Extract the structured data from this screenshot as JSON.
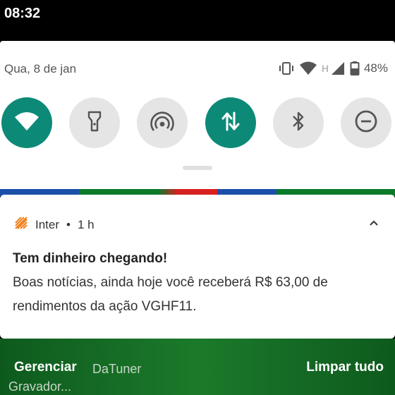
{
  "status_bar": {
    "time": "08:32"
  },
  "shade": {
    "date": "Qua, 8 de jan",
    "battery": "48%",
    "icons": [
      "vibrate-icon",
      "wifi-icon",
      "network-type-icon",
      "signal-icon",
      "battery-icon"
    ],
    "network_type": "H"
  },
  "quick_settings": [
    {
      "name": "wifi",
      "icon": "wifi-icon",
      "state": "on"
    },
    {
      "name": "flashlight",
      "icon": "flashlight-icon",
      "state": "off"
    },
    {
      "name": "hotspot",
      "icon": "hotspot-icon",
      "state": "off"
    },
    {
      "name": "mobile-data",
      "icon": "mobile-data-icon",
      "state": "on"
    },
    {
      "name": "bluetooth",
      "icon": "bluetooth-icon",
      "state": "off"
    },
    {
      "name": "do-not-disturb",
      "icon": "do-not-disturb-icon",
      "state": "off"
    }
  ],
  "colors": {
    "accent": "#0d8a77",
    "tile_off": "#e5e5e5",
    "app_icon": "#f07e1b"
  },
  "notification": {
    "app": "Inter",
    "separator": "•",
    "time": "1 h",
    "title": "Tem dinheiro chegando!",
    "body": "Boas notícias, ainda hoje você receberá R$ 63,00 de rendimentos da ação VGHF11."
  },
  "background_labels": {
    "label_1": "DaTuner",
    "label_2": "Gravador..."
  },
  "actions": {
    "manage": "Gerenciar",
    "clear_all": "Limpar tudo"
  }
}
